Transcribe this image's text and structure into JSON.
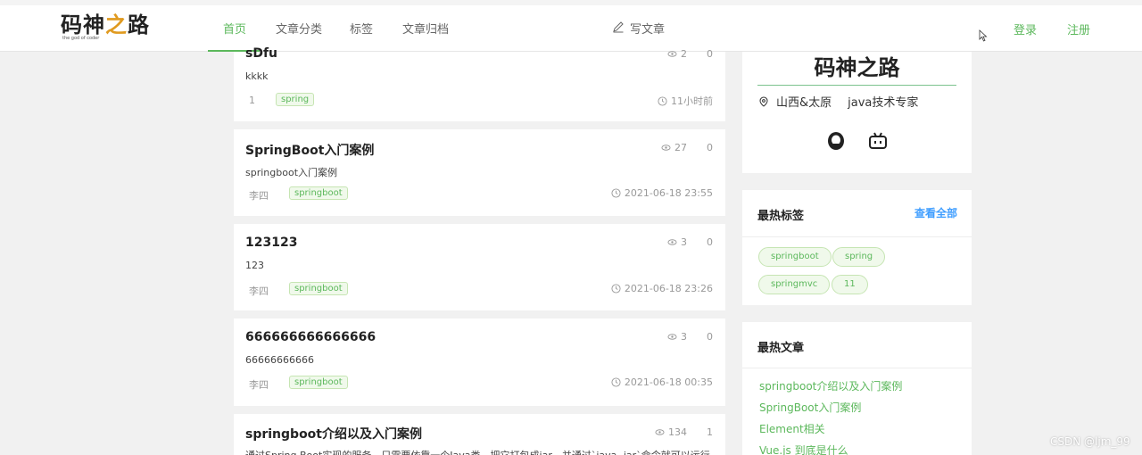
{
  "nav": {
    "logo_main_a": "码神",
    "logo_main_b": "之",
    "logo_main_c": "路",
    "logo_sub": "the god of coder",
    "items": [
      "首页",
      "文章分类",
      "标签",
      "文章归档"
    ],
    "write": "写文章",
    "login": "登录",
    "register": "注册"
  },
  "articles": [
    {
      "title": "sDfu",
      "summary": "kkkk",
      "author": "1",
      "tag": "spring",
      "views": "2",
      "comments": "0",
      "time": "11小时前"
    },
    {
      "title": "SpringBoot入门案例",
      "summary": "springboot入门案例",
      "author": "李四",
      "tag": "springboot",
      "views": "27",
      "comments": "0",
      "time": "2021-06-18 23:55"
    },
    {
      "title": "123123",
      "summary": "123",
      "author": "李四",
      "tag": "springboot",
      "views": "3",
      "comments": "0",
      "time": "2021-06-18 23:26"
    },
    {
      "title": "666666666666666",
      "summary": "66666666666",
      "author": "李四",
      "tag": "springboot",
      "views": "3",
      "comments": "0",
      "time": "2021-06-18 00:35"
    },
    {
      "title": "springboot介绍以及入门案例",
      "summary": "通过Spring Boot实现的服务，只需要依靠一个Java类，把它打包成jar，并通过`java -jar`命令就可以运行",
      "views": "134",
      "comments": "1"
    }
  ],
  "profile": {
    "name": "码神之路",
    "location": "山西&太原",
    "title": "java技术专家"
  },
  "hot_tags": {
    "header": "最热标签",
    "more": "查看全部",
    "tags": [
      "springboot",
      "spring",
      "springmvc",
      "11"
    ]
  },
  "hot_articles": {
    "header": "最热文章",
    "items": [
      "springboot介绍以及入门案例",
      "SpringBoot入门案例",
      "Element相关",
      "Vue.js 到底是什么"
    ]
  },
  "watermark": "CSDN @ljm_99",
  "colors": {
    "accent": "#5cb85c",
    "link_blue": "#409eff"
  }
}
